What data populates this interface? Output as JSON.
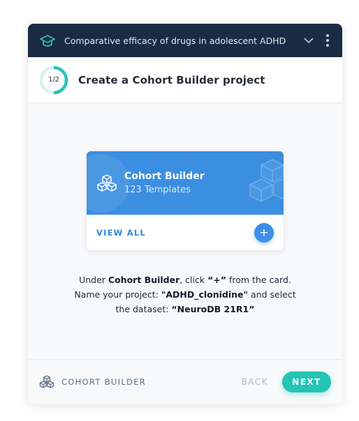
{
  "header": {
    "title": "Comparative efficacy of drugs in adolescent ADHD",
    "icon": "graduation-cap-icon",
    "accent": "#25c4b4",
    "background": "#1b2b44"
  },
  "step": {
    "progress_label": "1/2",
    "progress_fraction": 0.5,
    "title": "Create a Cohort Builder project"
  },
  "card": {
    "name": "Cohort Builder",
    "subtitle": "123 Templates",
    "view_all": "VIEW ALL",
    "plus": "+",
    "color": "#3b8fe0"
  },
  "instructions": {
    "l1_a": "Under ",
    "l1_b": "Cohort Builder",
    "l1_c": ", click ",
    "l1_d": "“+”",
    "l1_e": " from the card.",
    "l2_a": "Name your project: ",
    "l2_b": "\"ADHD_clonidine\"",
    "l2_c": " and select",
    "l3_a": "the dataset: ",
    "l3_b": "“NeuroDB 21R1”"
  },
  "footer": {
    "label": "COHORT BUILDER",
    "back": "BACK",
    "next": "NEXT",
    "next_color": "#25c4b4"
  }
}
